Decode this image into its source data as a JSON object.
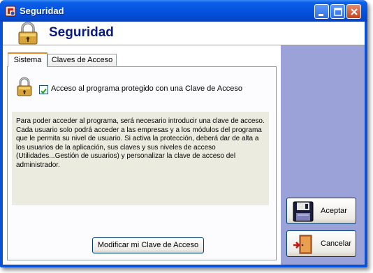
{
  "window": {
    "title": "Seguridad"
  },
  "header": {
    "title": "Seguridad"
  },
  "tabs": [
    {
      "label": "Sistema",
      "active": true
    },
    {
      "label": "Claves de Acceso",
      "active": false
    }
  ],
  "sistema": {
    "protect_checkbox": {
      "label": "Acceso al programa protegido con una Clave de Acceso",
      "checked": true
    },
    "info_text": "Para poder acceder al programa, será necesario introducir una clave de acceso. Cada usuario solo podrá acceder a las empresas y a los módulos del programa que le permita su nivel de usuario. Si activa la protección, deberá dar de alta a los usuarios de la aplicación, sus claves y sus niveles de acceso (Utilidades...Gestión de usuarios) y personalizar la clave de acceso  del administrador.",
    "modify_button": "Modificar mi Clave de Acceso"
  },
  "actions": {
    "accept": "Aceptar",
    "cancel": "Cancelar"
  },
  "icons": {
    "app": "app-icon",
    "minimize": "minimize-icon",
    "maximize": "maximize-icon",
    "close": "close-icon",
    "header": "padlock-icon",
    "accept": "floppy-disk-icon",
    "cancel": "exit-door-icon"
  }
}
